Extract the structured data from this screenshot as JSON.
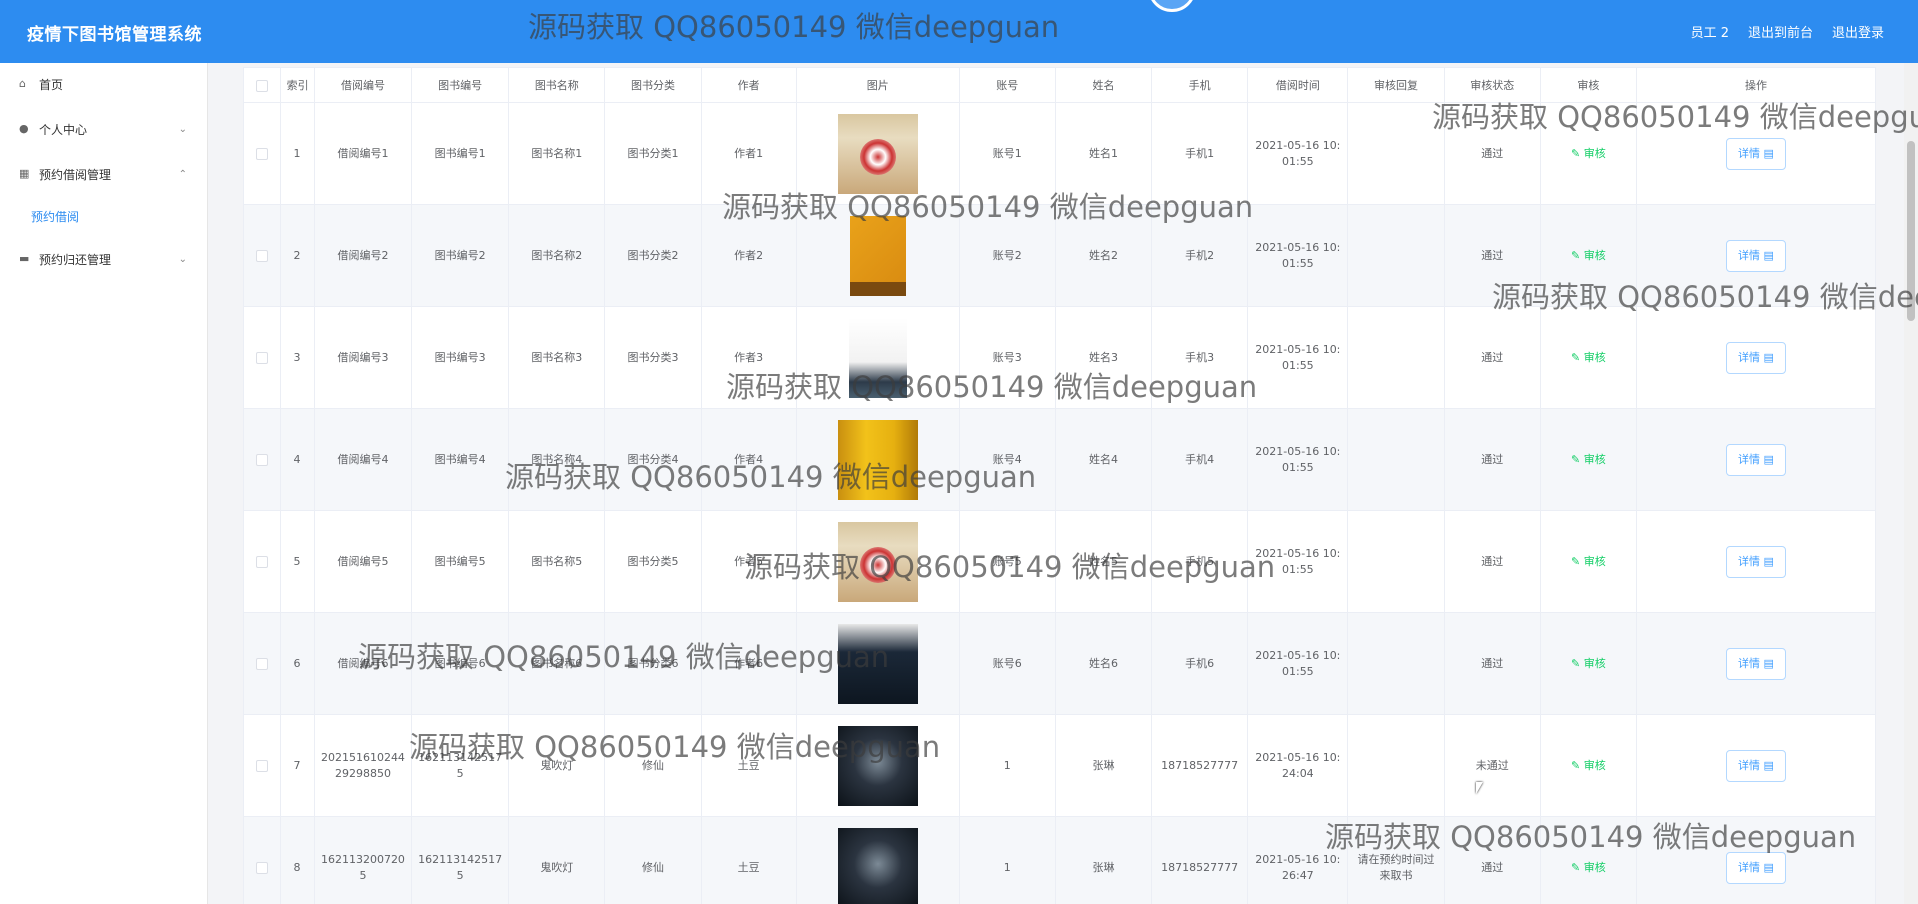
{
  "app": {
    "title": "疫情下图书馆管理系统",
    "user": "员工 2",
    "back_front": "退出到前台",
    "logout": "退出登录"
  },
  "sidebar": {
    "items": [
      {
        "label": "首页",
        "icon": "home-icon"
      },
      {
        "label": "个人中心",
        "icon": "user-icon"
      },
      {
        "label": "预约借阅管理",
        "icon": "grid-icon"
      },
      {
        "label": "预约借阅",
        "icon": ""
      },
      {
        "label": "预约归还管理",
        "icon": "briefcase-icon"
      }
    ]
  },
  "table": {
    "headers": [
      "",
      "索引",
      "借阅编号",
      "图书编号",
      "图书名称",
      "图书分类",
      "作者",
      "图片",
      "账号",
      "姓名",
      "手机",
      "借阅时间",
      "审核回复",
      "审核状态",
      "审核",
      "操作"
    ],
    "audit_label": "审核",
    "detail_label": "详情",
    "rows": [
      {
        "idx": "1",
        "borrow_no": "借阅编号1",
        "book_no": "图书编号1",
        "book_name": "图书名称1",
        "category": "图书分类1",
        "author": "作者1",
        "account": "账号1",
        "name": "姓名1",
        "phone": "手机1",
        "time": "2021-05-16 10:01:55",
        "reply": "",
        "status": "通过"
      },
      {
        "idx": "2",
        "borrow_no": "借阅编号2",
        "book_no": "图书编号2",
        "book_name": "图书名称2",
        "category": "图书分类2",
        "author": "作者2",
        "account": "账号2",
        "name": "姓名2",
        "phone": "手机2",
        "time": "2021-05-16 10:01:55",
        "reply": "",
        "status": "通过"
      },
      {
        "idx": "3",
        "borrow_no": "借阅编号3",
        "book_no": "图书编号3",
        "book_name": "图书名称3",
        "category": "图书分类3",
        "author": "作者3",
        "account": "账号3",
        "name": "姓名3",
        "phone": "手机3",
        "time": "2021-05-16 10:01:55",
        "reply": "",
        "status": "通过"
      },
      {
        "idx": "4",
        "borrow_no": "借阅编号4",
        "book_no": "图书编号4",
        "book_name": "图书名称4",
        "category": "图书分类4",
        "author": "作者4",
        "account": "账号4",
        "name": "姓名4",
        "phone": "手机4",
        "time": "2021-05-16 10:01:55",
        "reply": "",
        "status": "通过"
      },
      {
        "idx": "5",
        "borrow_no": "借阅编号5",
        "book_no": "图书编号5",
        "book_name": "图书名称5",
        "category": "图书分类5",
        "author": "作者5",
        "account": "账号5",
        "name": "姓名5",
        "phone": "手机5",
        "time": "2021-05-16 10:01:55",
        "reply": "",
        "status": "通过"
      },
      {
        "idx": "6",
        "borrow_no": "借阅编号6",
        "book_no": "图书编号6",
        "book_name": "图书名称6",
        "category": "图书分类6",
        "author": "作者6",
        "account": "账号6",
        "name": "姓名6",
        "phone": "手机6",
        "time": "2021-05-16 10:01:55",
        "reply": "",
        "status": "通过"
      },
      {
        "idx": "7",
        "borrow_no": "20215161024429298850",
        "book_no": "1621131425175",
        "book_name": "鬼吹灯",
        "category": "修仙",
        "author": "土豆",
        "account": "1",
        "name": "张琳",
        "phone": "18718527777",
        "time": "2021-05-16 10:24:04",
        "reply": "",
        "status": "未通过"
      },
      {
        "idx": "8",
        "borrow_no": "1621132007205",
        "book_no": "1621131425175",
        "book_name": "鬼吹灯",
        "category": "修仙",
        "author": "土豆",
        "account": "1",
        "name": "张琳",
        "phone": "18718527777",
        "time": "2021-05-16 10:26:47",
        "reply": "请在预约时间过来取书",
        "status": "通过"
      }
    ]
  },
  "watermark": "源码获取 QQ86050149 微信deepguan"
}
